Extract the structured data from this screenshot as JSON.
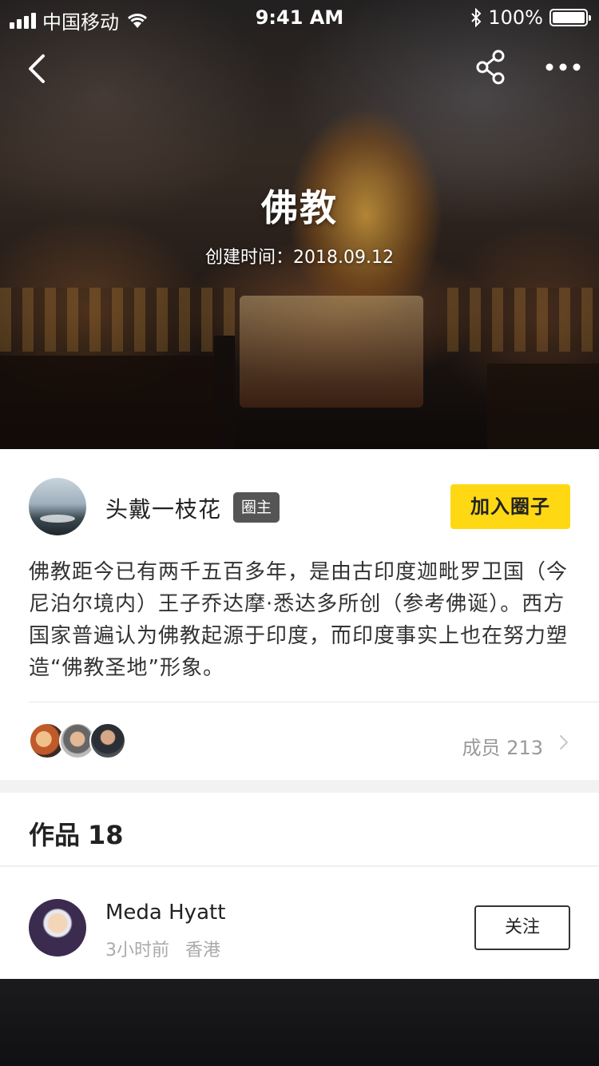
{
  "status_bar": {
    "carrier": "中国移动",
    "time": "9:41 AM",
    "battery_text": "100%",
    "battery_level": 1.0
  },
  "nav": {
    "back_icon": "chevron-left-icon",
    "share_icon": "share-icon",
    "more_icon": "more-horizontal-icon"
  },
  "hero": {
    "title": "佛教",
    "created": "创建时间：2018.09.12"
  },
  "circle": {
    "owner_name": "头戴一枝花",
    "owner_badge": "圈主",
    "join_label": "加入圈子",
    "description": "佛教距今已有两千五百多年，是由古印度迦毗罗卫国（今尼泊尔境内）王子乔达摩·悉达多所创（参考佛诞）。西方国家普遍认为佛教起源于印度，而印度事实上也在努力塑造“佛教圣地”形象。",
    "members_label": "成员 213"
  },
  "works": {
    "title": "作品",
    "count": "18"
  },
  "post": {
    "author": "Meda Hyatt",
    "time": "3小时前",
    "location": "香港",
    "follow_label": "关注"
  },
  "colors": {
    "accent": "#ffd814",
    "badge_bg": "#555555",
    "muted_text": "#999999"
  }
}
